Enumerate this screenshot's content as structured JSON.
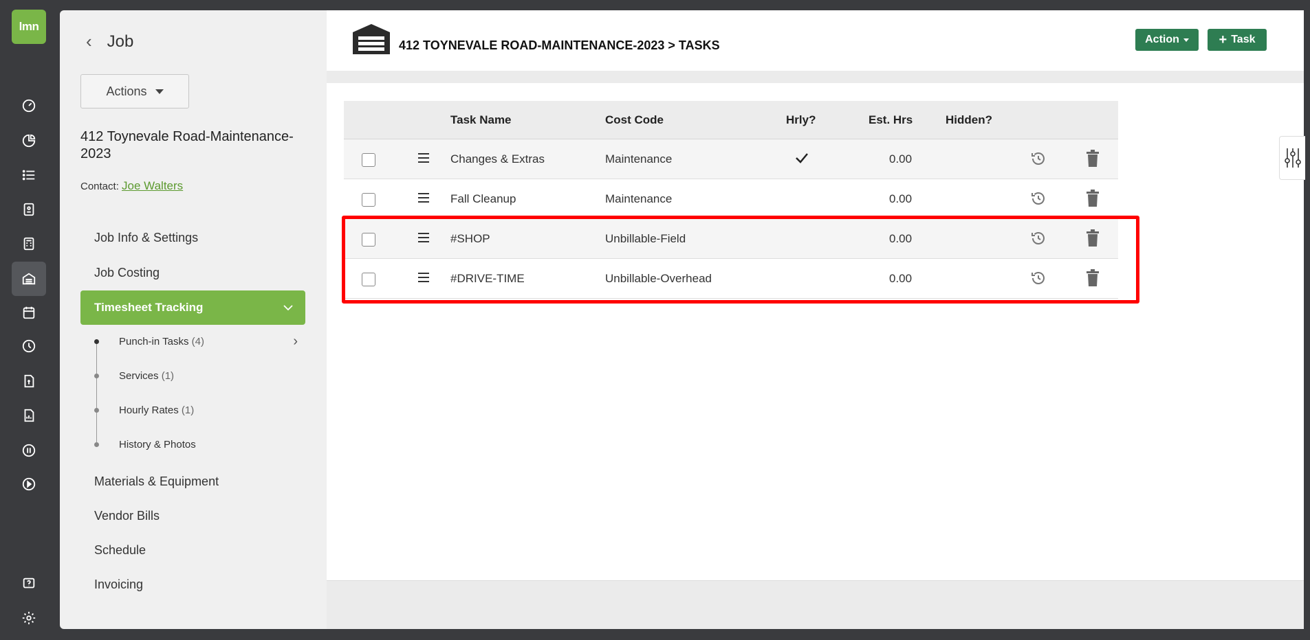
{
  "rail": {
    "logo": "lmn",
    "icons": [
      "dashboard-icon",
      "pie-chart-icon",
      "list-icon",
      "contacts-icon",
      "calculator-icon",
      "jobs-icon",
      "calendar-icon",
      "clock-icon",
      "estimate-icon",
      "report-icon",
      "quickbooks-icon",
      "play-icon",
      "help-icon",
      "settings-icon"
    ]
  },
  "job_panel": {
    "title": "Job",
    "actions_label": "Actions",
    "job_name": "412 Toynevale Road-Maintenance-2023",
    "contact_label": "Contact:",
    "contact_name": "Joe Walters",
    "nav": {
      "job_info": "Job Info & Settings",
      "job_costing": "Job Costing",
      "timesheet": "Timesheet Tracking",
      "materials": "Materials & Equipment",
      "vendor_bills": "Vendor Bills",
      "schedule": "Schedule",
      "invoicing": "Invoicing"
    },
    "sub_nav": [
      {
        "label": "Punch-in Tasks",
        "count": "(4)"
      },
      {
        "label": "Services",
        "count": "(1)"
      },
      {
        "label": "Hourly Rates",
        "count": "(1)"
      },
      {
        "label": "History & Photos",
        "count": ""
      }
    ]
  },
  "main": {
    "breadcrumb": "412 TOYNEVALE ROAD-MAINTENANCE-2023 > TASKS",
    "action_button": "Action",
    "task_button": "Task",
    "columns": {
      "task_name": "Task Name",
      "cost_code": "Cost Code",
      "hourly": "Hrly?",
      "est_hrs": "Est. Hrs",
      "hidden": "Hidden?"
    },
    "rows": [
      {
        "task": "Changes & Extras",
        "cost_code": "Maintenance",
        "hourly": true,
        "est_hrs": "0.00"
      },
      {
        "task": "Fall Cleanup",
        "cost_code": "Maintenance",
        "hourly": false,
        "est_hrs": "0.00"
      },
      {
        "task": "#SHOP",
        "cost_code": "Unbillable-Field",
        "hourly": false,
        "est_hrs": "0.00"
      },
      {
        "task": "#DRIVE-TIME",
        "cost_code": "Unbillable-Overhead",
        "hourly": false,
        "est_hrs": "0.00"
      }
    ]
  },
  "colors": {
    "brand_green": "#7ab648",
    "button_green": "#2e7d52",
    "highlight_red": "#ff0000",
    "rail_bg": "#3a3b3e"
  }
}
